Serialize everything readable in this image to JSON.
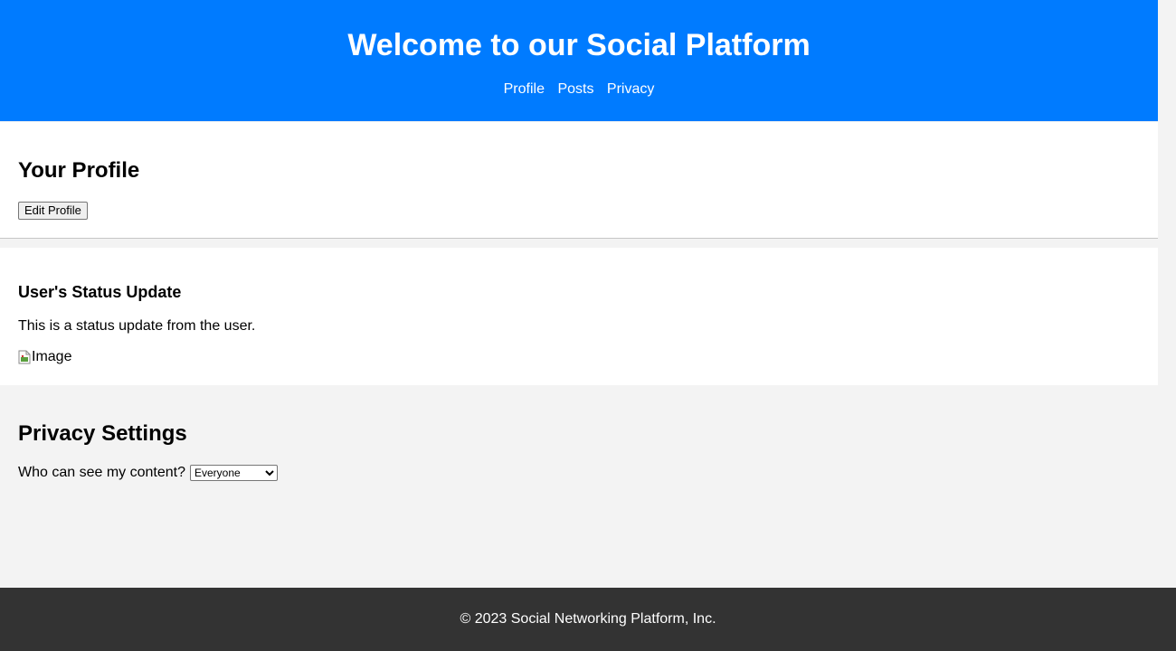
{
  "header": {
    "title": "Welcome to our Social Platform",
    "nav": [
      "Profile",
      "Posts",
      "Privacy"
    ]
  },
  "profile": {
    "heading": "Your Profile",
    "edit_button": "Edit Profile"
  },
  "post": {
    "title": "User's Status Update",
    "body": "This is a status update from the user.",
    "image_alt": "Image"
  },
  "privacy": {
    "heading": "Privacy Settings",
    "label": "Who can see my content?",
    "selected": "Everyone"
  },
  "footer": {
    "text": "© 2023 Social Networking Platform, Inc."
  },
  "colors": {
    "header_bg": "#007bff",
    "footer_bg": "#333333",
    "page_bg": "#f3f3f3"
  }
}
